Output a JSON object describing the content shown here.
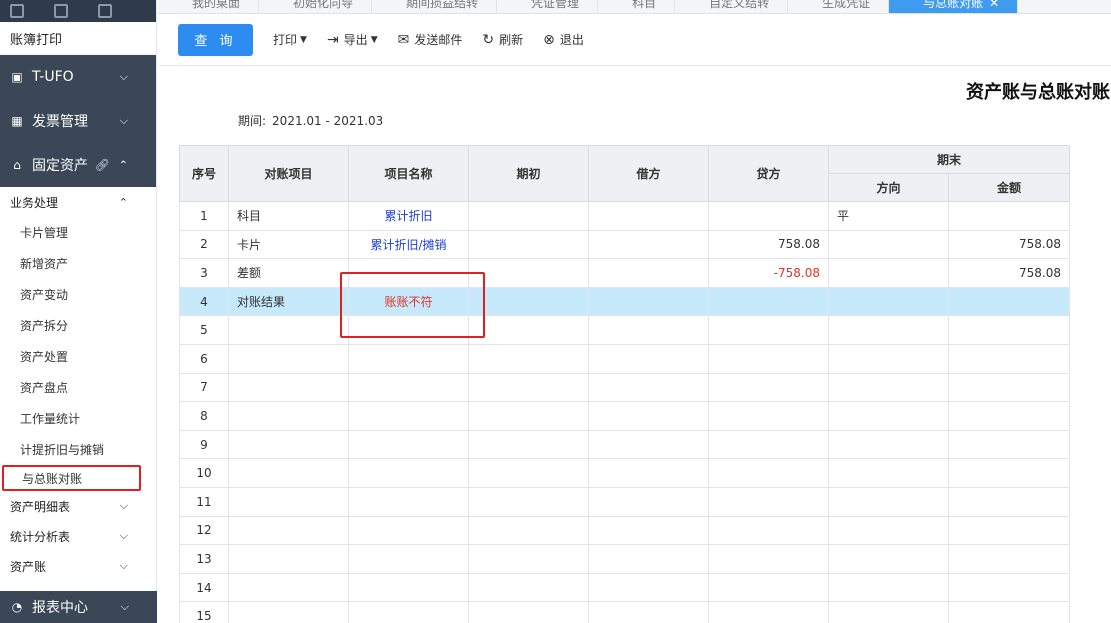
{
  "sidebar": {
    "print_label": "账簿打印",
    "ufo_label": "T-UFO",
    "invoice_label": "发票管理",
    "fixed_assets_label": "固定资产",
    "business_group_label": "业务处理",
    "items": [
      {
        "label": "卡片管理"
      },
      {
        "label": "新增资产"
      },
      {
        "label": "资产变动"
      },
      {
        "label": "资产拆分"
      },
      {
        "label": "资产处置"
      },
      {
        "label": "资产盘点"
      },
      {
        "label": "工作量统计"
      },
      {
        "label": "计提折旧与摊销"
      },
      {
        "label": "与总账对账"
      }
    ],
    "detail_label": "资产明细表",
    "stats_label": "统计分析表",
    "ledger_label": "资产账",
    "report_center_label": "报表中心"
  },
  "tabs": [
    {
      "label": "我的桌面"
    },
    {
      "label": "初始化向导"
    },
    {
      "label": "期间损益结转"
    },
    {
      "label": "凭证管理"
    },
    {
      "label": "科目"
    },
    {
      "label": "自定义结转"
    },
    {
      "label": "生成凭证"
    },
    {
      "label": "与总账对账"
    }
  ],
  "toolbar": {
    "query_label": "查 询",
    "print_label": "打印",
    "export_label": "导出",
    "email_label": "发送邮件",
    "refresh_label": "刷新",
    "exit_label": "退出"
  },
  "report": {
    "title": "资产账与总账对账",
    "period_label": "期间:",
    "period_value": "2021.01 - 2021.03"
  },
  "table": {
    "headers": {
      "seq": "序号",
      "item": "对账项目",
      "name": "项目名称",
      "opening": "期初",
      "debit": "借方",
      "credit": "贷方",
      "closing": "期末",
      "direction": "方向",
      "amount": "金额"
    },
    "rows": [
      {
        "seq": "1",
        "item": "科目",
        "name": "累计折旧",
        "opening": "",
        "debit": "",
        "credit": "",
        "direction": "平",
        "amount": ""
      },
      {
        "seq": "2",
        "item": "卡片",
        "name": "累计折旧/摊销",
        "opening": "",
        "debit": "",
        "credit": "758.08",
        "direction": "",
        "amount": "758.08"
      },
      {
        "seq": "3",
        "item": "差额",
        "name": "",
        "opening": "",
        "debit": "",
        "credit": "-758.08",
        "direction": "",
        "amount": "758.08"
      },
      {
        "seq": "4",
        "item": "对账结果",
        "name": "账账不符",
        "opening": "",
        "debit": "",
        "credit": "",
        "direction": "",
        "amount": ""
      },
      {
        "seq": "5"
      },
      {
        "seq": "6"
      },
      {
        "seq": "7"
      },
      {
        "seq": "8"
      },
      {
        "seq": "9"
      },
      {
        "seq": "10"
      },
      {
        "seq": "11"
      },
      {
        "seq": "12"
      },
      {
        "seq": "13"
      },
      {
        "seq": "14"
      },
      {
        "seq": "15"
      }
    ]
  },
  "colors": {
    "primary": "#2d8cf0",
    "sidebar_dark": "#3b4757",
    "highlight_row": "#c6e9fb",
    "mismatch_red": "#e0332b",
    "link_blue": "#1e3fd6"
  }
}
